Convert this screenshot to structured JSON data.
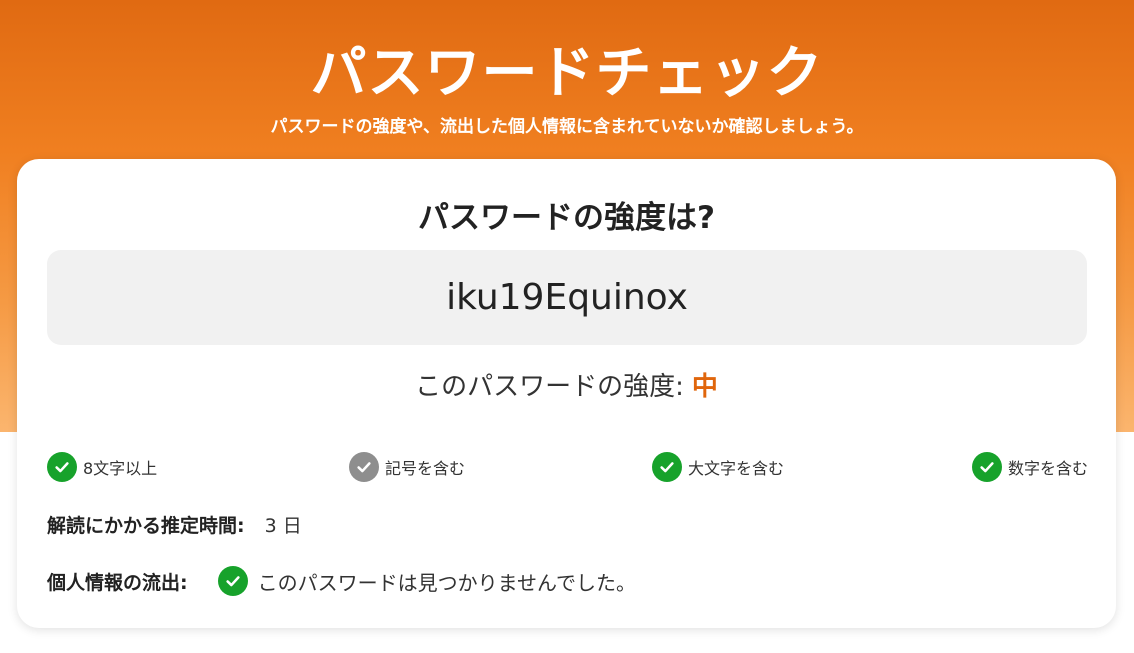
{
  "header": {
    "title": "パスワードチェック",
    "subtitle": "パスワードの強度や、流出した個人情報に含まれていないか確認しましょう。"
  },
  "card": {
    "heading": "パスワードの強度は?",
    "password_value": "iku19Equinox",
    "strength_label": "このパスワードの強度:",
    "strength_value": "中",
    "strength_color": "#e0660c"
  },
  "criteria": [
    {
      "label": "8文字以上",
      "met": true,
      "icon": "check-icon"
    },
    {
      "label": "記号を含む",
      "met": false,
      "icon": "check-icon"
    },
    {
      "label": "大文字を含む",
      "met": true,
      "icon": "check-icon"
    },
    {
      "label": "数字を含む",
      "met": true,
      "icon": "check-icon"
    }
  ],
  "crack_time": {
    "label": "解読にかかる推定時間:",
    "value": "3 日"
  },
  "leak": {
    "label": "個人情報の流出:",
    "value": "このパスワードは見つかりませんでした。",
    "icon": "check-icon"
  },
  "colors": {
    "accent": "#f07f20",
    "check_ok": "#17a22b",
    "check_off": "#8e8e8e"
  }
}
